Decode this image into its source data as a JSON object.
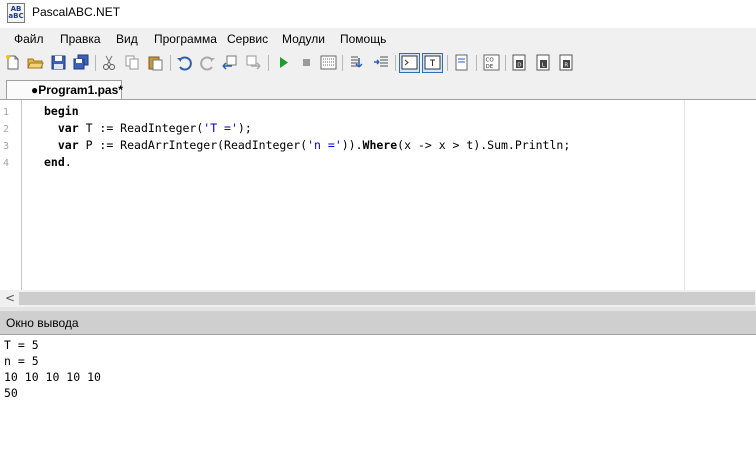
{
  "window": {
    "title": "PascalABC.NET",
    "icon_text": "AB\nаВС"
  },
  "menu": [
    "Файл",
    "Правка",
    "Вид",
    "Программа",
    "Сервис",
    "Модули",
    "Помощь"
  ],
  "toolbar": {
    "icons": [
      "new-file-icon",
      "open-folder-icon",
      "save-icon",
      "save-all-icon",
      "cut-icon",
      "copy-icon",
      "paste-icon",
      "undo-icon",
      "redo-icon",
      "step-back-icon",
      "step-forward-icon",
      "run-icon",
      "stop-icon",
      "compile-icon",
      "debug-step-icon",
      "debug-step-over-icon",
      "console-icon",
      "text-window-icon",
      "layout-icon",
      "format-code-icon",
      "dock-left-icon",
      "dock-bottom-icon",
      "dock-right-icon"
    ]
  },
  "tab": {
    "label": "●Program1.pas*"
  },
  "editor": {
    "line_numbers": [
      "1",
      "2",
      "3",
      "4"
    ],
    "lines": [
      "begin",
      "  var T := ReadInteger('T =');",
      "  var P := ReadArrInteger(ReadInteger('n =')).Where(x -> x > t).Sum.Println;",
      "end."
    ]
  },
  "output": {
    "title": "Окно вывода",
    "lines": [
      "T = 5",
      "n = 5",
      "10 10 10 10 10",
      "50"
    ]
  },
  "colors": {
    "keyword": "#000000",
    "string": "#0000c8",
    "chrome": "#f0f0f0",
    "output_header": "#cfcfcf"
  }
}
